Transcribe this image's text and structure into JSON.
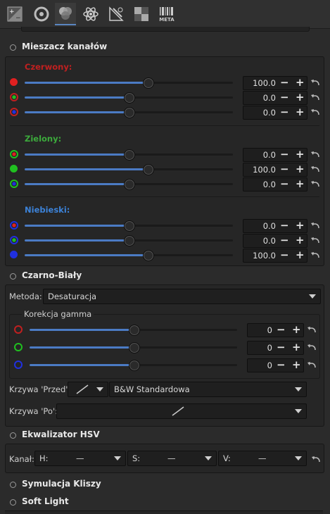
{
  "toolbar": {
    "tabs": [
      {
        "name": "exposure-tab-icon"
      },
      {
        "name": "detail-tab-icon"
      },
      {
        "name": "color-tab-icon"
      },
      {
        "name": "advanced-tab-icon"
      },
      {
        "name": "transform-tab-icon"
      },
      {
        "name": "raw-tab-icon"
      },
      {
        "name": "metadata-tab-icon",
        "label": "META"
      }
    ]
  },
  "channel_mixer": {
    "title": "Mieszacz kanałów",
    "groups": [
      {
        "label": "Czerwony:",
        "color": "#c02020",
        "rows": [
          {
            "value": "100.0",
            "fraction": 0.59
          },
          {
            "value": "0.0",
            "fraction": 0.5
          },
          {
            "value": "0.0",
            "fraction": 0.5
          }
        ]
      },
      {
        "label": "Zielony:",
        "color": "#3caa3c",
        "rows": [
          {
            "value": "0.0",
            "fraction": 0.5
          },
          {
            "value": "100.0",
            "fraction": 0.59
          },
          {
            "value": "0.0",
            "fraction": 0.5
          }
        ]
      },
      {
        "label": "Niebieski:",
        "color": "#3c82d8",
        "rows": [
          {
            "value": "0.0",
            "fraction": 0.5
          },
          {
            "value": "0.0",
            "fraction": 0.5
          },
          {
            "value": "100.0",
            "fraction": 0.59
          }
        ]
      }
    ]
  },
  "bw": {
    "title": "Czarno-Biały",
    "method_label": "Metoda:",
    "method_value": "Desaturacja",
    "gamma_title": "Korekcja gamma",
    "gamma_rows": [
      {
        "value": "0",
        "fraction": 0.5
      },
      {
        "value": "0",
        "fraction": 0.5
      },
      {
        "value": "0",
        "fraction": 0.5
      }
    ],
    "curve_before_label": "Krzywa 'Przed':",
    "curve_before_value": "B&W Standardowa",
    "curve_after_label": "Krzywa 'Po':"
  },
  "hsv": {
    "title": "Ekwalizator HSV",
    "channel_label": "Kanał:",
    "h_label": "H:",
    "s_label": "S:",
    "v_label": "V:",
    "dash": "—"
  },
  "film_sim": {
    "title": "Symulacja Kliszy"
  },
  "soft_light": {
    "title": "Soft Light"
  },
  "colors": {
    "accent": "#4b7bc4",
    "red": "#e02020",
    "green": "#20c020",
    "blue": "#2030e0"
  }
}
